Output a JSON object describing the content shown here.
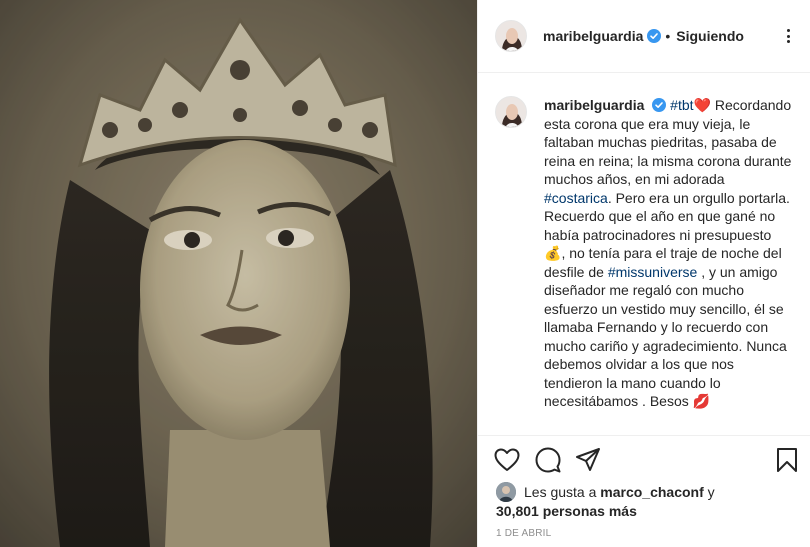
{
  "post": {
    "username": "maribelguardia",
    "follow_status": "Siguiendo"
  },
  "caption": {
    "username": "maribelguardia",
    "hashtag_tbt": "#tbt",
    "heart_emoji": "❤️",
    "text_1": "Recordando esta corona que era muy vieja, le faltaban muchas piedritas, pasaba de reina en reina; la misma corona durante muchos años, en mi adorada ",
    "hashtag_costarica": "#costarica",
    "text_2": ". Pero era un orgullo portarla. Recuerdo que el año en que gané no había patrocinadores ni presupuesto ",
    "money_emoji": "💰",
    "text_3": ", no tenía para el traje de noche del desfile de ",
    "hashtag_missuniverse": "#missuniverse",
    "text_4": " , y un amigo diseñador me regaló con mucho esfuerzo un vestido muy sencillo, él se llamaba Fernando y lo recuerdo con mucho cariño y agradecimiento. Nunca debemos olvidar a los que nos tendieron la mano cuando lo necesitábamos . Besos ",
    "lips_emoji": "💋"
  },
  "likes": {
    "prefix": "Les gusta a ",
    "liker": "marco_chaconf",
    "joiner": " y",
    "count_text": "30,801 personas más"
  },
  "date": "1 DE ABRIL",
  "colors": {
    "link": "#00376b",
    "verified": "#3897f0",
    "text": "#262626",
    "muted": "#8e8e8e",
    "border": "#efefef"
  },
  "icons": [
    "verified-badge-icon",
    "more-options-icon",
    "heart-icon",
    "comment-icon",
    "share-icon",
    "save-icon"
  ]
}
